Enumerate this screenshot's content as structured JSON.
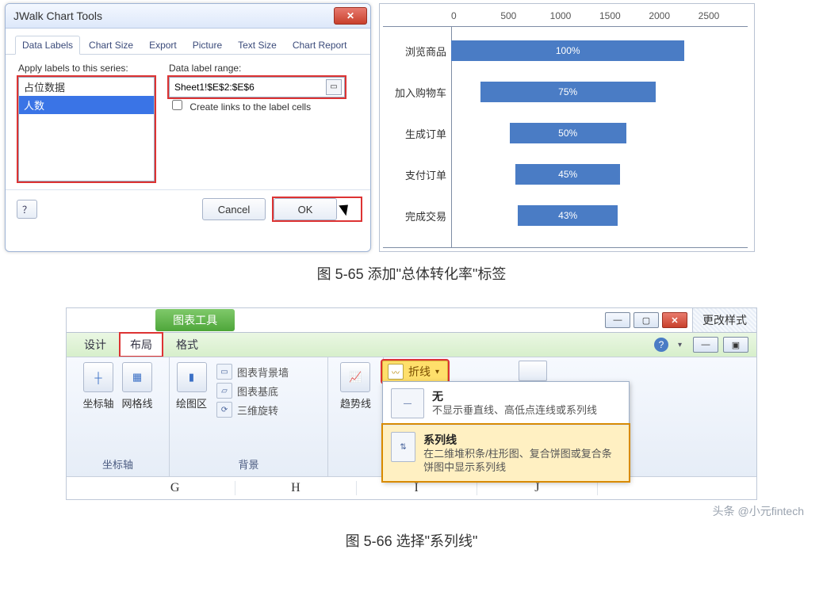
{
  "fig65": {
    "dialog": {
      "title": "JWalk Chart Tools",
      "tabs": [
        "Data Labels",
        "Chart Size",
        "Export",
        "Picture",
        "Text Size",
        "Chart Report"
      ],
      "active_tab": 0,
      "apply_label": "Apply labels to this series:",
      "series": [
        "占位数据",
        "人数"
      ],
      "selected_series": 1,
      "range_label": "Data label range:",
      "range_value": "Sheet1!$E$2:$E$6",
      "create_links": "Create links to the label cells",
      "cancel": "Cancel",
      "ok": "OK",
      "help": "？"
    },
    "caption": "图 5-65  添加\"总体转化率\"标签"
  },
  "chart_data": {
    "type": "bar",
    "orientation": "horizontal",
    "xlabel": "",
    "ylabel": "",
    "xlim": [
      0,
      2500
    ],
    "xticks": [
      0,
      500,
      1000,
      1500,
      2000,
      2500
    ],
    "categories": [
      "浏览商品",
      "加入购物车",
      "生成订单",
      "支付订单",
      "完成交易"
    ],
    "series": [
      {
        "name": "占位数据",
        "values": [
          0,
          250,
          500,
          550,
          570
        ],
        "visible": false
      },
      {
        "name": "人数",
        "values": [
          2000,
          1500,
          1000,
          900,
          860
        ]
      }
    ],
    "data_labels": [
      "100%",
      "75%",
      "50%",
      "45%",
      "43%"
    ]
  },
  "fig66": {
    "context_tab": "图表工具",
    "side_panel": "更改样式",
    "tabs": [
      "设计",
      "布局",
      "格式"
    ],
    "active_tab": 1,
    "group_axes": {
      "items": [
        "坐标轴",
        "网格线"
      ],
      "label": "坐标轴"
    },
    "group_plot": {
      "item": "绘图区"
    },
    "group_bg": {
      "items": [
        "图表背景墙",
        "图表基底",
        "三维旋转"
      ],
      "label": "背景"
    },
    "trend_item": "趋势线",
    "lines_btn": "折线",
    "dropdown": {
      "items": [
        {
          "title": "无",
          "desc": "不显示垂直线、高低点连线或系列线"
        },
        {
          "title": "系列线",
          "desc": "在二维堆积条/柱形图、复合饼图或复合条饼图中显示系列线"
        }
      ],
      "highlight": 1
    },
    "ws_cells": [
      "G",
      "H",
      "I",
      "J"
    ],
    "caption": "图 5-66  选择\"系列线\"",
    "watermark": "头条 @小元fintech"
  }
}
